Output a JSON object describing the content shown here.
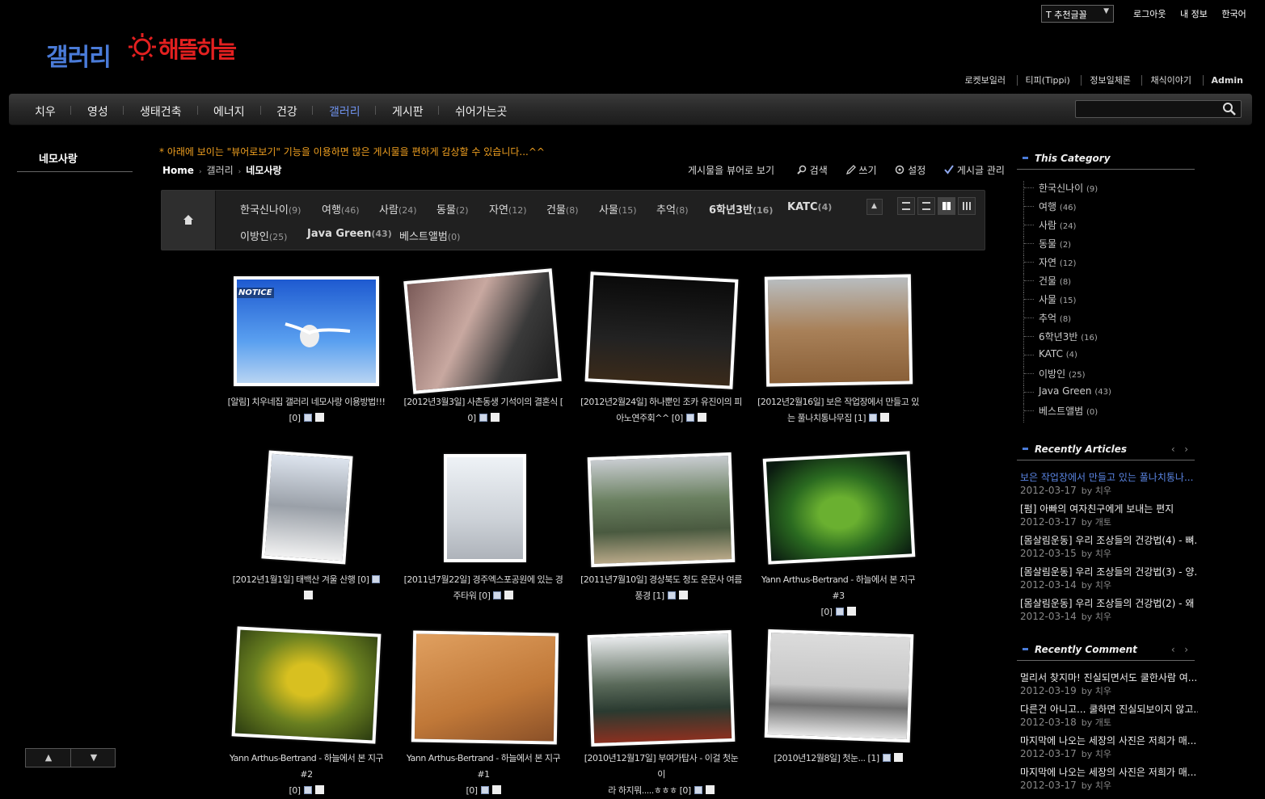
{
  "header": {
    "logo_text": "갤러리",
    "brand_text": "해뜰하늘",
    "font_select": "T 추천글꼴",
    "top_links": [
      "로그아웃",
      "내 정보",
      "한국어"
    ],
    "quick_links": [
      "로켓보일러",
      "티피(Tippi)",
      "정보일체론",
      "채식이야기",
      "Admin"
    ]
  },
  "nav": {
    "items": [
      "치우",
      "영성",
      "생태건축",
      "에너지",
      "건강",
      "갤러리",
      "게시판",
      "쉬어가는곳"
    ],
    "active_index": 5,
    "search_placeholder": ""
  },
  "left": {
    "menu_item": "네모사랑",
    "up": "▲",
    "down": "▼"
  },
  "main": {
    "notice": "* 아래에 보이는 \"뷰어로보기\" 기능을 이용하면 많은 게시물을 편하게 감상할 수 있습니다...^^",
    "breadcrumb": [
      "Home",
      "갤러리",
      "네모사랑"
    ],
    "tools": [
      "게시물을 뷰어로 보기",
      "검색",
      "쓰기",
      "설정",
      "게시글 관리"
    ],
    "categories": [
      {
        "name": "한국신나이",
        "count": "(9)"
      },
      {
        "name": "여행",
        "count": "(46)"
      },
      {
        "name": "사람",
        "count": "(24)"
      },
      {
        "name": "동물",
        "count": "(2)"
      },
      {
        "name": "자연",
        "count": "(12)"
      },
      {
        "name": "건물",
        "count": "(8)"
      },
      {
        "name": "사물",
        "count": "(15)"
      },
      {
        "name": "추억",
        "count": "(8)"
      },
      {
        "name": "6학년3반",
        "count": "(16)"
      },
      {
        "name": "KATC",
        "count": "(4)"
      },
      {
        "name": "이방인",
        "count": "(25)"
      },
      {
        "name": "Java Green",
        "count": "(43)"
      },
      {
        "name": "베스트앨범",
        "count": "(0)"
      }
    ],
    "notice_badge": "NOTICE",
    "posts": [
      {
        "l1": "[알림] 치우네집 갤러리 네모사랑 이용방법!!!",
        "l2": "[0]"
      },
      {
        "l1": "[2012년3월3일] 사촌동생 기석이의 결혼식 [",
        "l2": "0]"
      },
      {
        "l1": "[2012년2월24일] 하나뿐인 조카 유진이의 피",
        "l2": "아노연주회^^ [0]"
      },
      {
        "l1": "[2012년2월16일] 보은 작업장에서 만들고 있",
        "l2": "는 풀나치통나무집 [1]"
      },
      {
        "l1": "[2012년1월1일] 태백산 겨울 산행 [0]",
        "l2": ""
      },
      {
        "l1": "[2011년7월22일] 경주엑스포공원에 있는 경",
        "l2": "주타워 [0]"
      },
      {
        "l1": "[2011년7월10일] 경상북도 청도 운문사 여름",
        "l2": "풍경 [1]"
      },
      {
        "l1": "Yann Arthus-Bertrand - 하늘에서 본 지구 #3",
        "l2": "[0]"
      },
      {
        "l1": "Yann Arthus-Bertrand - 하늘에서 본 지구 #2",
        "l2": "[0]"
      },
      {
        "l1": "Yann Arthus-Bertrand - 하늘에서 본 지구 #1",
        "l2": "[0]"
      },
      {
        "l1": "[2010년12월17일] 부여가탑사 - 이걸 첫눈이",
        "l2": "라 하지뭐.....ㅎㅎㅎ [0]"
      },
      {
        "l1": "[2010년12월8일] 첫눈... [1]",
        "l2": ""
      }
    ]
  },
  "sidebar": {
    "category_title": "This Category",
    "categories": [
      {
        "name": "한국신나이",
        "count": "(9)"
      },
      {
        "name": "여행",
        "count": "(46)"
      },
      {
        "name": "사람",
        "count": "(24)"
      },
      {
        "name": "동물",
        "count": "(2)"
      },
      {
        "name": "자연",
        "count": "(12)"
      },
      {
        "name": "건물",
        "count": "(8)"
      },
      {
        "name": "사물",
        "count": "(15)"
      },
      {
        "name": "추억",
        "count": "(8)"
      },
      {
        "name": "6학년3반",
        "count": "(16)"
      },
      {
        "name": "KATC",
        "count": "(4)"
      },
      {
        "name": "이방인",
        "count": "(25)"
      },
      {
        "name": "Java Green",
        "count": "(43)"
      },
      {
        "name": "베스트앨범",
        "count": "(0)"
      }
    ],
    "recent_title": "Recently Articles",
    "recent_articles": [
      {
        "title": "보은 작업장에서 만들고 있는 풀나치통나...",
        "date": "2012-03-17",
        "by": "by 치우"
      },
      {
        "title": "[펌] 아빠의 여자친구에게 보내는 편지",
        "date": "2012-03-17",
        "by": "by 개토"
      },
      {
        "title": "[몸살림운동] 우리 조상들의 건강법(4) - 뼈...",
        "date": "2012-03-15",
        "by": "by 치우"
      },
      {
        "title": "[몸살림운동] 우리 조상들의 건강법(3) - 양...",
        "date": "2012-03-14",
        "by": "by 치우"
      },
      {
        "title": "[몸살림운동] 우리 조상들의 건강법(2) - 왜 ...",
        "date": "2012-03-14",
        "by": "by 치우"
      }
    ],
    "comment_title": "Recently Comment",
    "recent_comments": [
      {
        "title": "멀리서 찾지마! 진실되면서도 쿨한사람 여...",
        "date": "2012-03-19",
        "by": "by 치우"
      },
      {
        "title": "다른건 아니고... 쿨하면 진실되보이지 않고...",
        "date": "2012-03-18",
        "by": "by 개토"
      },
      {
        "title": "마지막에 나오는 세장의 사진은 저희가 매...",
        "date": "2012-03-17",
        "by": "by 치우"
      },
      {
        "title": "마지막에 나오는 세장의 사진은 저희가 매...",
        "date": "2012-03-17",
        "by": "by 치우"
      }
    ],
    "pager_prev": "‹",
    "pager_next": "›"
  }
}
